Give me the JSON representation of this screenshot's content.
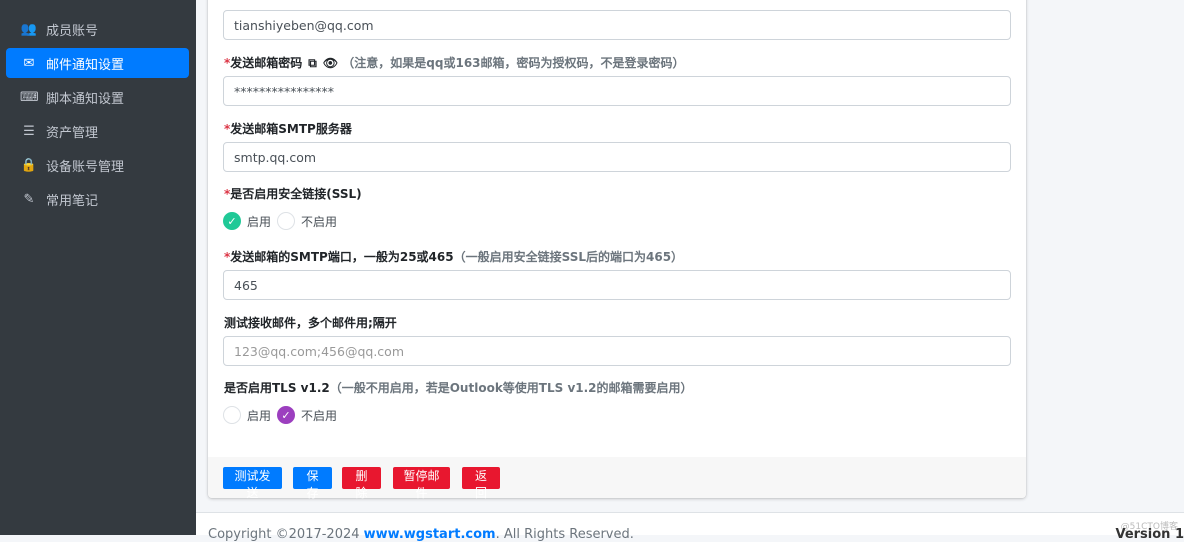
{
  "sidebar": {
    "items": [
      {
        "label": "成员账号",
        "icon": "users-icon",
        "glyph": "👥"
      },
      {
        "label": "邮件通知设置",
        "icon": "envelope-icon",
        "glyph": "✉",
        "active": true
      },
      {
        "label": "脚本通知设置",
        "icon": "keyboard-icon",
        "glyph": "⌨"
      },
      {
        "label": "资产管理",
        "icon": "server-icon",
        "glyph": "☰"
      },
      {
        "label": "设备账号管理",
        "icon": "lock-icon",
        "glyph": "🔒"
      },
      {
        "label": "常用笔记",
        "icon": "edit-icon",
        "glyph": "✎"
      }
    ]
  },
  "form": {
    "sender_email": {
      "value": "tianshiyeben@qq.com"
    },
    "password": {
      "label": "发送邮箱密码",
      "hint": "（注意，如果是qq或163邮箱，密码为授权码，不是登录密码）",
      "value": "****************"
    },
    "smtp_server": {
      "label": "发送邮箱SMTP服务器",
      "value": "smtp.qq.com"
    },
    "ssl": {
      "label": "是否启用安全链接(SSL)",
      "options": [
        "启用",
        "不启用"
      ],
      "selected": "启用",
      "color": "#20c997"
    },
    "port": {
      "label": "发送邮箱的SMTP端口，一般为25或465",
      "hint": "（一般启用安全链接SSL后的端口为465）",
      "value": "465"
    },
    "test_recipients": {
      "label": "测试接收邮件，多个邮件用;隔开",
      "placeholder": "123@qq.com;456@qq.com"
    },
    "tls": {
      "label": "是否启用TLS v1.2",
      "hint": "（一般不用启用，若是Outlook等使用TLS v1.2的邮箱需要启用）",
      "options": [
        "启用",
        "不启用"
      ],
      "selected": "不启用",
      "color": "#9c3fbf"
    }
  },
  "buttons": {
    "test": "测试发送",
    "save": "保 存",
    "delete": "删 除",
    "pause": "暂停邮件",
    "back": "返 回"
  },
  "footer": {
    "copyright": "Copyright ©2017-2024 ",
    "link": "www.wgstart.com",
    "rights": ". All Rights Reserved.",
    "version": "Version 1",
    "watermark": "@51CTO博客"
  }
}
